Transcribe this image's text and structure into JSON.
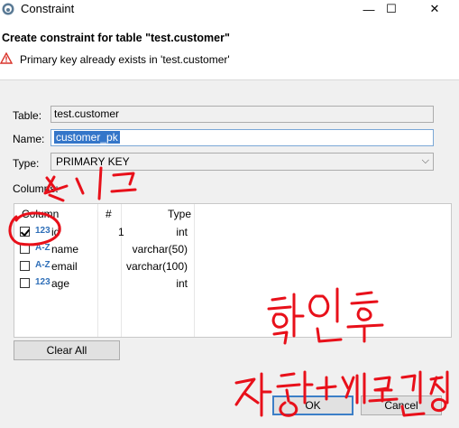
{
  "window": {
    "title": "Constraint",
    "minimize_glyph": "—",
    "maximize_glyph": "☐",
    "close_glyph": "✕"
  },
  "header": {
    "title": "Create constraint for table \"test.customer\"",
    "message": "Primary key already exists in 'test.customer'"
  },
  "form": {
    "table_label": "Table:",
    "table_value": "test.customer",
    "name_label": "Name:",
    "name_value": "customer_pk",
    "type_label": "Type:",
    "type_value": "PRIMARY KEY",
    "columns_label": "Columns:"
  },
  "columns_table": {
    "headers": [
      "Column",
      "#",
      "Type"
    ],
    "rows": [
      {
        "checked": true,
        "icon": "123",
        "name": "id",
        "ordinal": "1",
        "type": "int"
      },
      {
        "checked": false,
        "icon": "A-Z",
        "name": "name",
        "ordinal": "",
        "type": "varchar(50)"
      },
      {
        "checked": false,
        "icon": "A-Z",
        "name": "email",
        "ordinal": "",
        "type": "varchar(100)"
      },
      {
        "checked": false,
        "icon": "123",
        "name": "age",
        "ordinal": "",
        "type": "int"
      }
    ]
  },
  "buttons": {
    "clear_all": "Clear All",
    "ok": "OK",
    "cancel": "Cancel"
  },
  "colors": {
    "accent": "#3c7fc7",
    "annotation_red": "#e8101a",
    "selection": "#3476c9"
  }
}
